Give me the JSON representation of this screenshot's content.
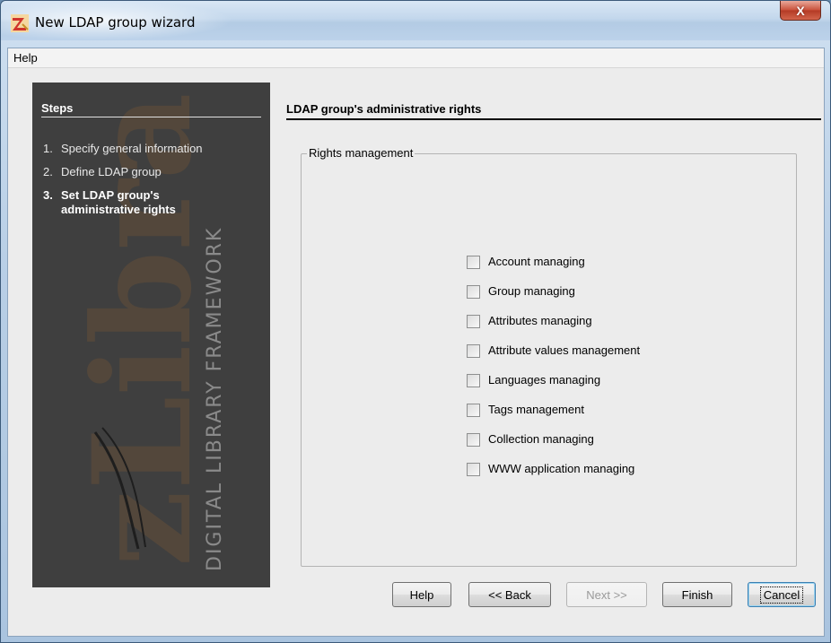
{
  "window": {
    "title": "New LDAP group wizard",
    "close_glyph": "X",
    "app_icon": "zlibra-app-icon"
  },
  "menubar": {
    "items": [
      "Help"
    ]
  },
  "sidebar": {
    "heading": "Steps",
    "watermark_text": "zLibra",
    "watermark_subtext": "DIGITAL LIBRARY FRAMEWORK",
    "steps": [
      {
        "num": "1.",
        "label": "Specify general information"
      },
      {
        "num": "2.",
        "label": "Define LDAP group"
      },
      {
        "num": "3.",
        "label_line1": "Set LDAP group's",
        "label_line2": "administrative rights"
      }
    ]
  },
  "content": {
    "title": "LDAP group's administrative rights",
    "group_label": "Rights management",
    "rights": [
      "Account managing",
      "Group managing",
      "Attributes managing",
      "Attribute values management",
      "Languages managing",
      "Tags management",
      "Collection managing",
      "WWW application managing"
    ]
  },
  "buttons": {
    "help": "Help",
    "back": "<< Back",
    "next": "Next >>",
    "finish": "Finish",
    "cancel": "Cancel"
  },
  "colors": {
    "sidebar_bg": "#3f3f3f",
    "dialog_bg": "#ececec",
    "close_button": "#c9503a"
  }
}
